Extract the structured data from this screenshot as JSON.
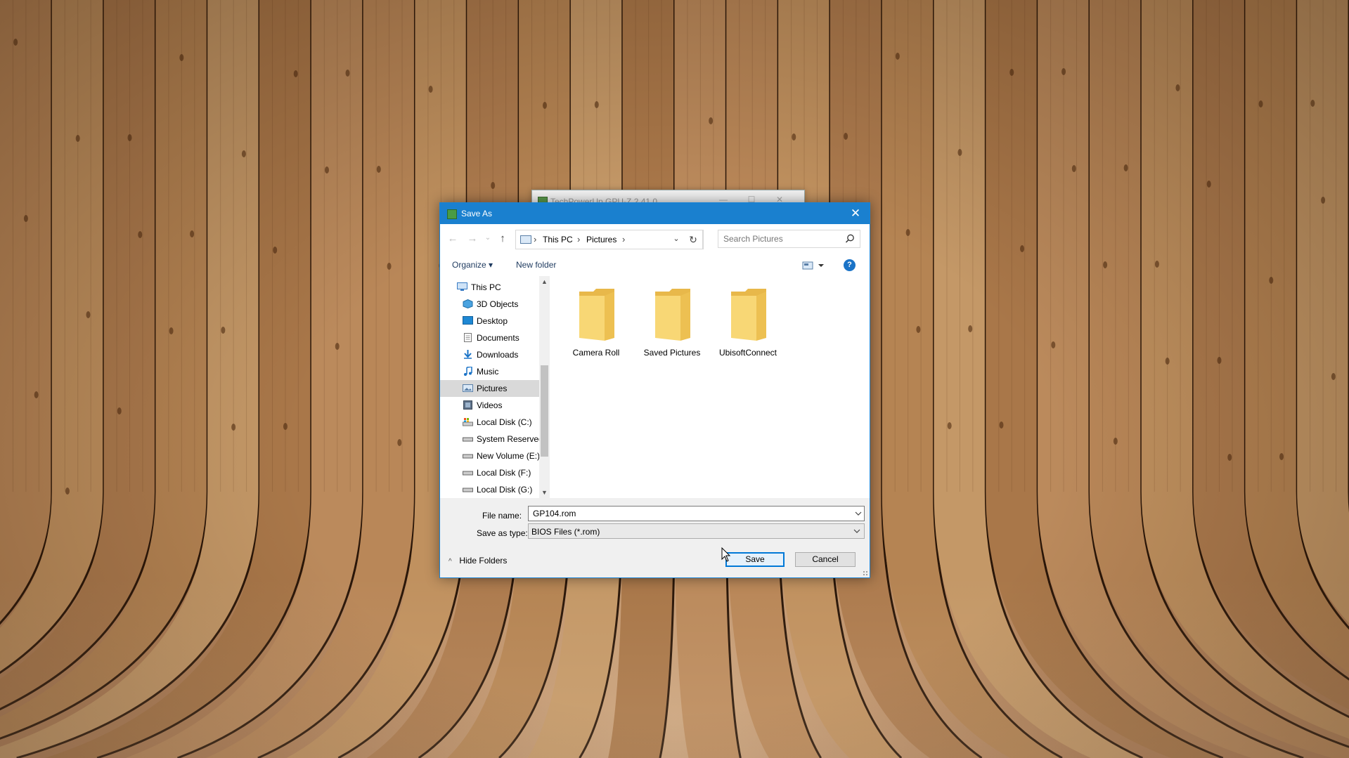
{
  "background_window": {
    "title": "TechPowerUp GPU-Z 2.41.0",
    "controls": [
      "—",
      "☐",
      "✕"
    ]
  },
  "dialog": {
    "title": "Save As",
    "close_glyph": "✕",
    "nav": {
      "back_glyph": "←",
      "forward_glyph": "→",
      "recent_glyph": "⌄",
      "up_glyph": "↑"
    },
    "address": {
      "crumbs": [
        "This PC",
        "Pictures"
      ],
      "separator": "›",
      "dropdown_glyph": "⌄",
      "refresh_glyph": "↻"
    },
    "search": {
      "placeholder": "Search Pictures"
    },
    "commands": {
      "organize": "Organize ▾",
      "new_folder": "New folder",
      "help_glyph": "?"
    },
    "navpane": {
      "items": [
        {
          "label": "This PC",
          "icon": "pc-icon"
        },
        {
          "label": "3D Objects",
          "icon": "3d-objects-icon"
        },
        {
          "label": "Desktop",
          "icon": "desktop-icon"
        },
        {
          "label": "Documents",
          "icon": "documents-icon"
        },
        {
          "label": "Downloads",
          "icon": "downloads-icon"
        },
        {
          "label": "Music",
          "icon": "music-icon"
        },
        {
          "label": "Pictures",
          "icon": "pictures-icon",
          "selected": true
        },
        {
          "label": "Videos",
          "icon": "videos-icon"
        },
        {
          "label": "Local Disk (C:)",
          "icon": "system-drive-icon"
        },
        {
          "label": "System Reserved",
          "icon": "drive-icon"
        },
        {
          "label": "New Volume (E:)",
          "icon": "drive-icon"
        },
        {
          "label": "Local Disk (F:)",
          "icon": "drive-icon"
        },
        {
          "label": "Local Disk (G:)",
          "icon": "drive-icon"
        }
      ],
      "scroll_up_glyph": "▲",
      "scroll_down_glyph": "▼"
    },
    "folders": [
      {
        "label": "Camera Roll"
      },
      {
        "label": "Saved Pictures"
      },
      {
        "label": "UbisoftConnect"
      }
    ],
    "file_name": {
      "label": "File name:",
      "value": "GP104.rom"
    },
    "save_as_type": {
      "label": "Save as type:",
      "value": "BIOS Files (*.rom)"
    },
    "buttons": {
      "save": "Save",
      "cancel": "Cancel"
    },
    "hide_folders": {
      "label": "Hide Folders",
      "glyph": "^"
    }
  },
  "colors": {
    "titlebar": "#1a80cf",
    "accent": "#0078d7",
    "folder": "#f8d775"
  }
}
